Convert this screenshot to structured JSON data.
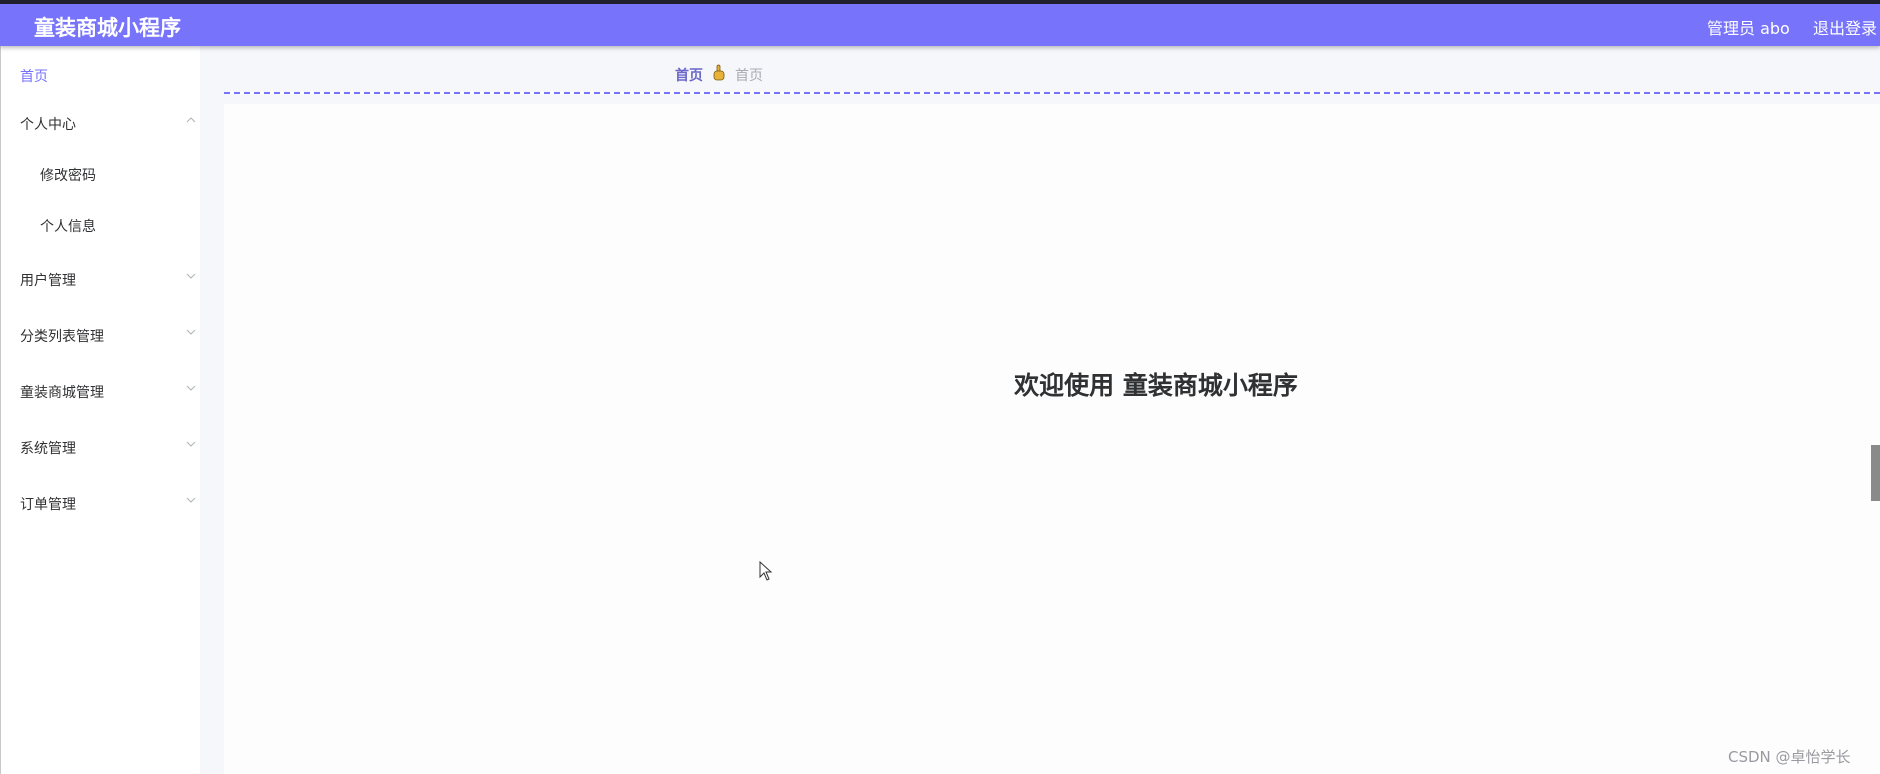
{
  "header": {
    "app_title": "童装商城小程序",
    "user_label": "管理员 abo",
    "logout_label": "退出登录",
    "bg_color": "#7773fb"
  },
  "sidebar": {
    "items": [
      {
        "label": "首页",
        "active": true
      },
      {
        "label": "个人中心",
        "expanded": true,
        "icon": "chevron-up-icon"
      },
      {
        "label": "修改密码",
        "sub": true
      },
      {
        "label": "个人信息",
        "sub": true
      },
      {
        "label": "用户管理",
        "icon": "chevron-down-icon"
      },
      {
        "label": "分类列表管理",
        "icon": "chevron-down-icon"
      },
      {
        "label": "童装商城管理",
        "icon": "chevron-down-icon"
      },
      {
        "label": "系统管理",
        "icon": "chevron-down-icon"
      },
      {
        "label": "订单管理",
        "icon": "chevron-down-icon"
      }
    ]
  },
  "breadcrumb": {
    "home": "首页",
    "separator_icon": "hand-icon",
    "current": "首页"
  },
  "main": {
    "welcome": "欢迎使用 童装商城小程序"
  },
  "watermark": "CSDN @卓怡学长",
  "colors": {
    "accent": "#7773fb",
    "breadcrumb_home": "#6a67c9",
    "text": "#303133"
  }
}
